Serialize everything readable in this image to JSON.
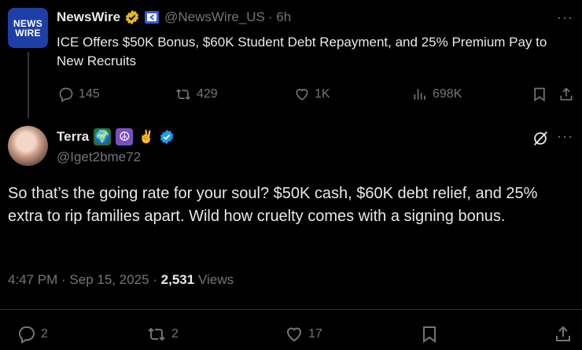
{
  "parent": {
    "logo_line1": "NEWS",
    "logo_line2": "WIRE",
    "name": "NewsWire",
    "handle": "@NewsWire_US",
    "time": "· 6h",
    "text": "ICE Offers $50K Bonus, $60K Student Debt Repayment, and 25% Premium Pay to New Recruits",
    "replies": "145",
    "reposts": "429",
    "likes": "1K",
    "views": "698K",
    "more": "···"
  },
  "reply": {
    "name": "Terra",
    "handle": "@Iget2bme72",
    "text": "So that’s the going rate for your soul? $50K cash, $60K debt relief, and 25% extra to rip families apart. Wild how cruelty comes with a signing bonus.",
    "time": "4:47 PM · Sep 15, 2025 · ",
    "views_count": "2,531",
    "views_label": " Views",
    "more": "···",
    "emojis": [
      "🌍",
      "☮",
      "✌"
    ],
    "replies": "2",
    "reposts": "2",
    "likes": "17"
  },
  "colors": {
    "verified_gold": "#e2b719",
    "verified_blue": "#1d9bf0",
    "muted": "#71767b"
  }
}
